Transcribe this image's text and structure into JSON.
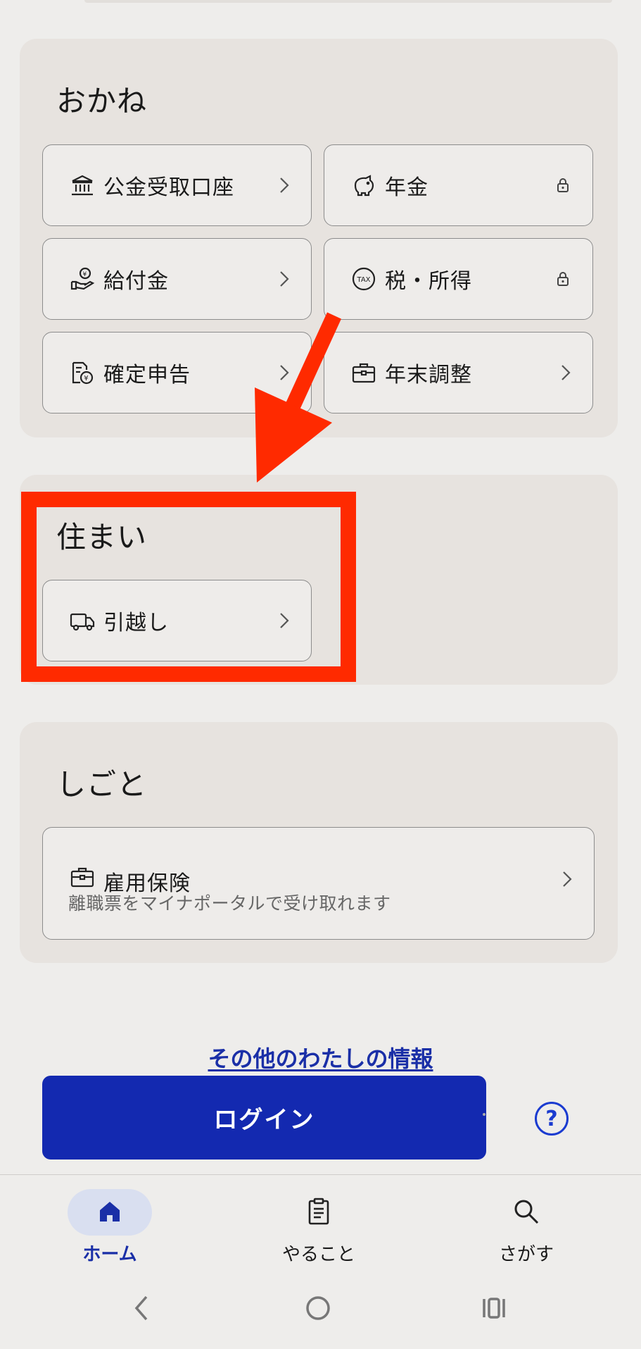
{
  "sections": {
    "money": {
      "title": "おかね",
      "tiles": [
        {
          "label": "公金受取口座",
          "icon": "bank-icon"
        },
        {
          "label": "年金",
          "icon": "piggy-bank-icon",
          "locked": true
        },
        {
          "label": "給付金",
          "icon": "hand-yen-icon"
        },
        {
          "label": "税・所得",
          "icon": "tax-icon",
          "locked": true
        },
        {
          "label": "確定申告",
          "icon": "tax-document-icon"
        },
        {
          "label": "年末調整",
          "icon": "briefcase-icon"
        }
      ]
    },
    "housing": {
      "title": "住まい",
      "tiles": [
        {
          "label": "引越し",
          "icon": "truck-icon"
        }
      ]
    },
    "work": {
      "title": "しごと",
      "tiles": [
        {
          "label": "雇用保険",
          "icon": "briefcase-icon",
          "sub": "離職票をマイナポータルで受け取れます"
        }
      ]
    }
  },
  "more_link": "その他のわたしの情報",
  "login_label": "ログイン",
  "help_label": "?",
  "bottom_nav": [
    {
      "label": "ホーム",
      "icon": "home-icon",
      "active": true
    },
    {
      "label": "やること",
      "icon": "clipboard-icon"
    },
    {
      "label": "さがす",
      "icon": "search-icon"
    }
  ],
  "system_nav": [
    "back-icon",
    "home-circle-icon",
    "recent-apps-icon"
  ],
  "annotation_color": "#ff2a00",
  "accent_color": "#1329b0"
}
